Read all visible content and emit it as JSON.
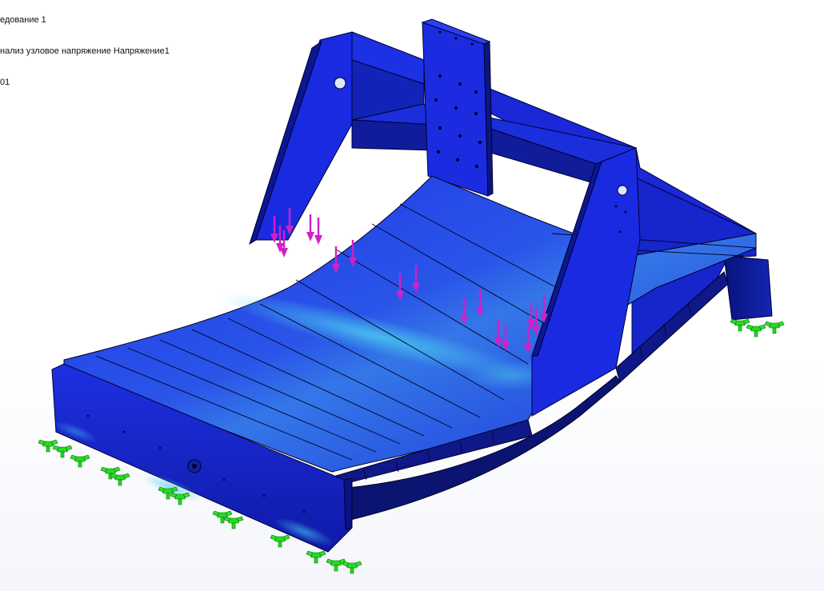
{
  "viewport": {
    "caption": {
      "line1": "едование 1",
      "line2": "нализ узловое напряжение Напряжение1",
      "line3": "01"
    }
  },
  "model": {
    "description_colors": {
      "body_blue": "#1a22e0",
      "body_dark": "#0a1380",
      "stress_highlight": "#3fb4e8",
      "load_arrow": "#d020c8",
      "fixture": "#22dd22",
      "edge": "#000022"
    },
    "load_arrow_count": 18,
    "fixture_count": 14,
    "features": [
      "left-side-plate",
      "right-side-plate",
      "center-mount-plate",
      "curved-deck",
      "front-beam",
      "right-rail"
    ]
  }
}
